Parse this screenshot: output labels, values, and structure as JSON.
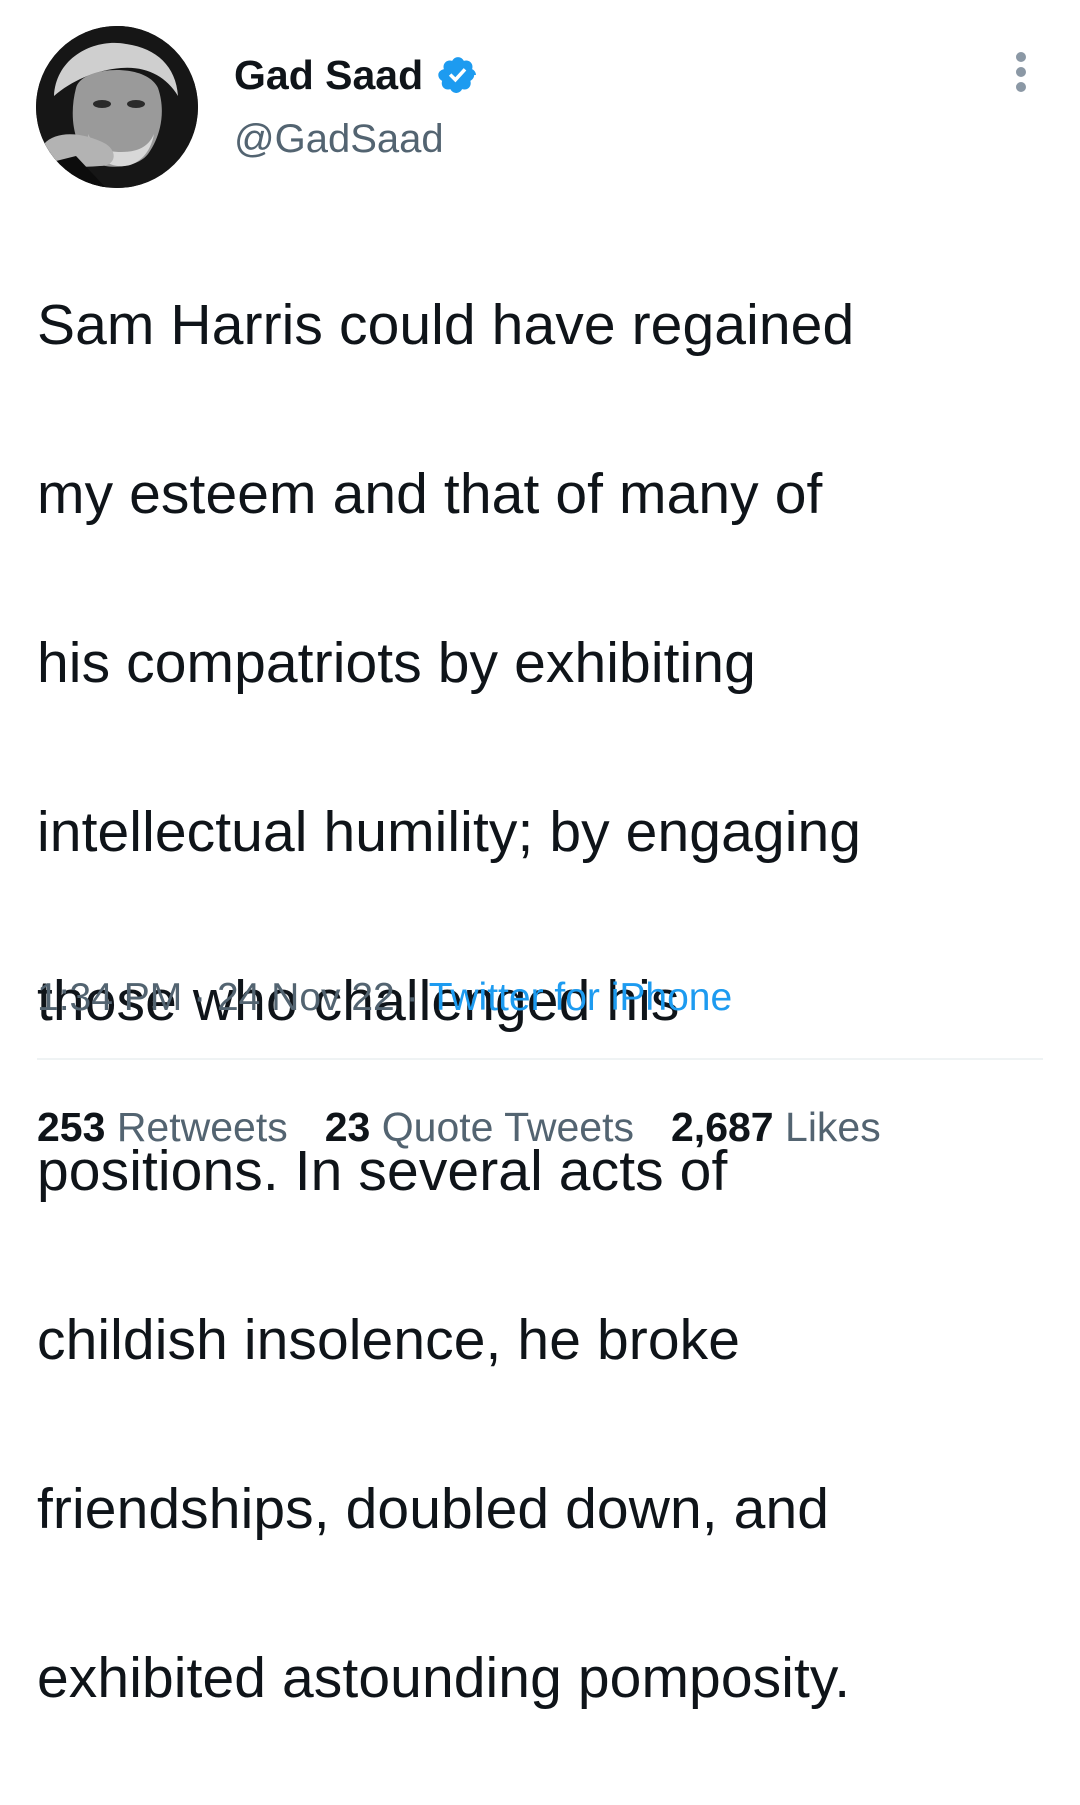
{
  "author": {
    "name": "Gad Saad",
    "handle": "@GadSaad",
    "verified": true,
    "verified_color": "#1d9bf0"
  },
  "tweet": {
    "text_lines": [
      "Sam Harris could have regained",
      "my esteem and that of many of",
      "his compatriots by exhibiting",
      "intellectual humility; by engaging",
      "those who challenged his",
      "positions. In several acts of",
      "childish insolence, he broke",
      "friendships, doubled down, and",
      "exhibited astounding pomposity."
    ],
    "time": "1:34 PM",
    "date": "24 Nov 22",
    "separator": "·",
    "source": "Twitter for iPhone"
  },
  "stats": {
    "retweets_count": "253",
    "retweets_label": "Retweets",
    "quotes_count": "23",
    "quotes_label": "Quote Tweets",
    "likes_count": "2,687",
    "likes_label": "Likes"
  },
  "icons": {
    "avatar": "profile-photo",
    "verified": "verified-badge-icon",
    "more": "more-options-icon"
  },
  "colors": {
    "text": "#0f1419",
    "secondary": "#536471",
    "link": "#1d9bf0",
    "divider": "#eff3f4"
  }
}
